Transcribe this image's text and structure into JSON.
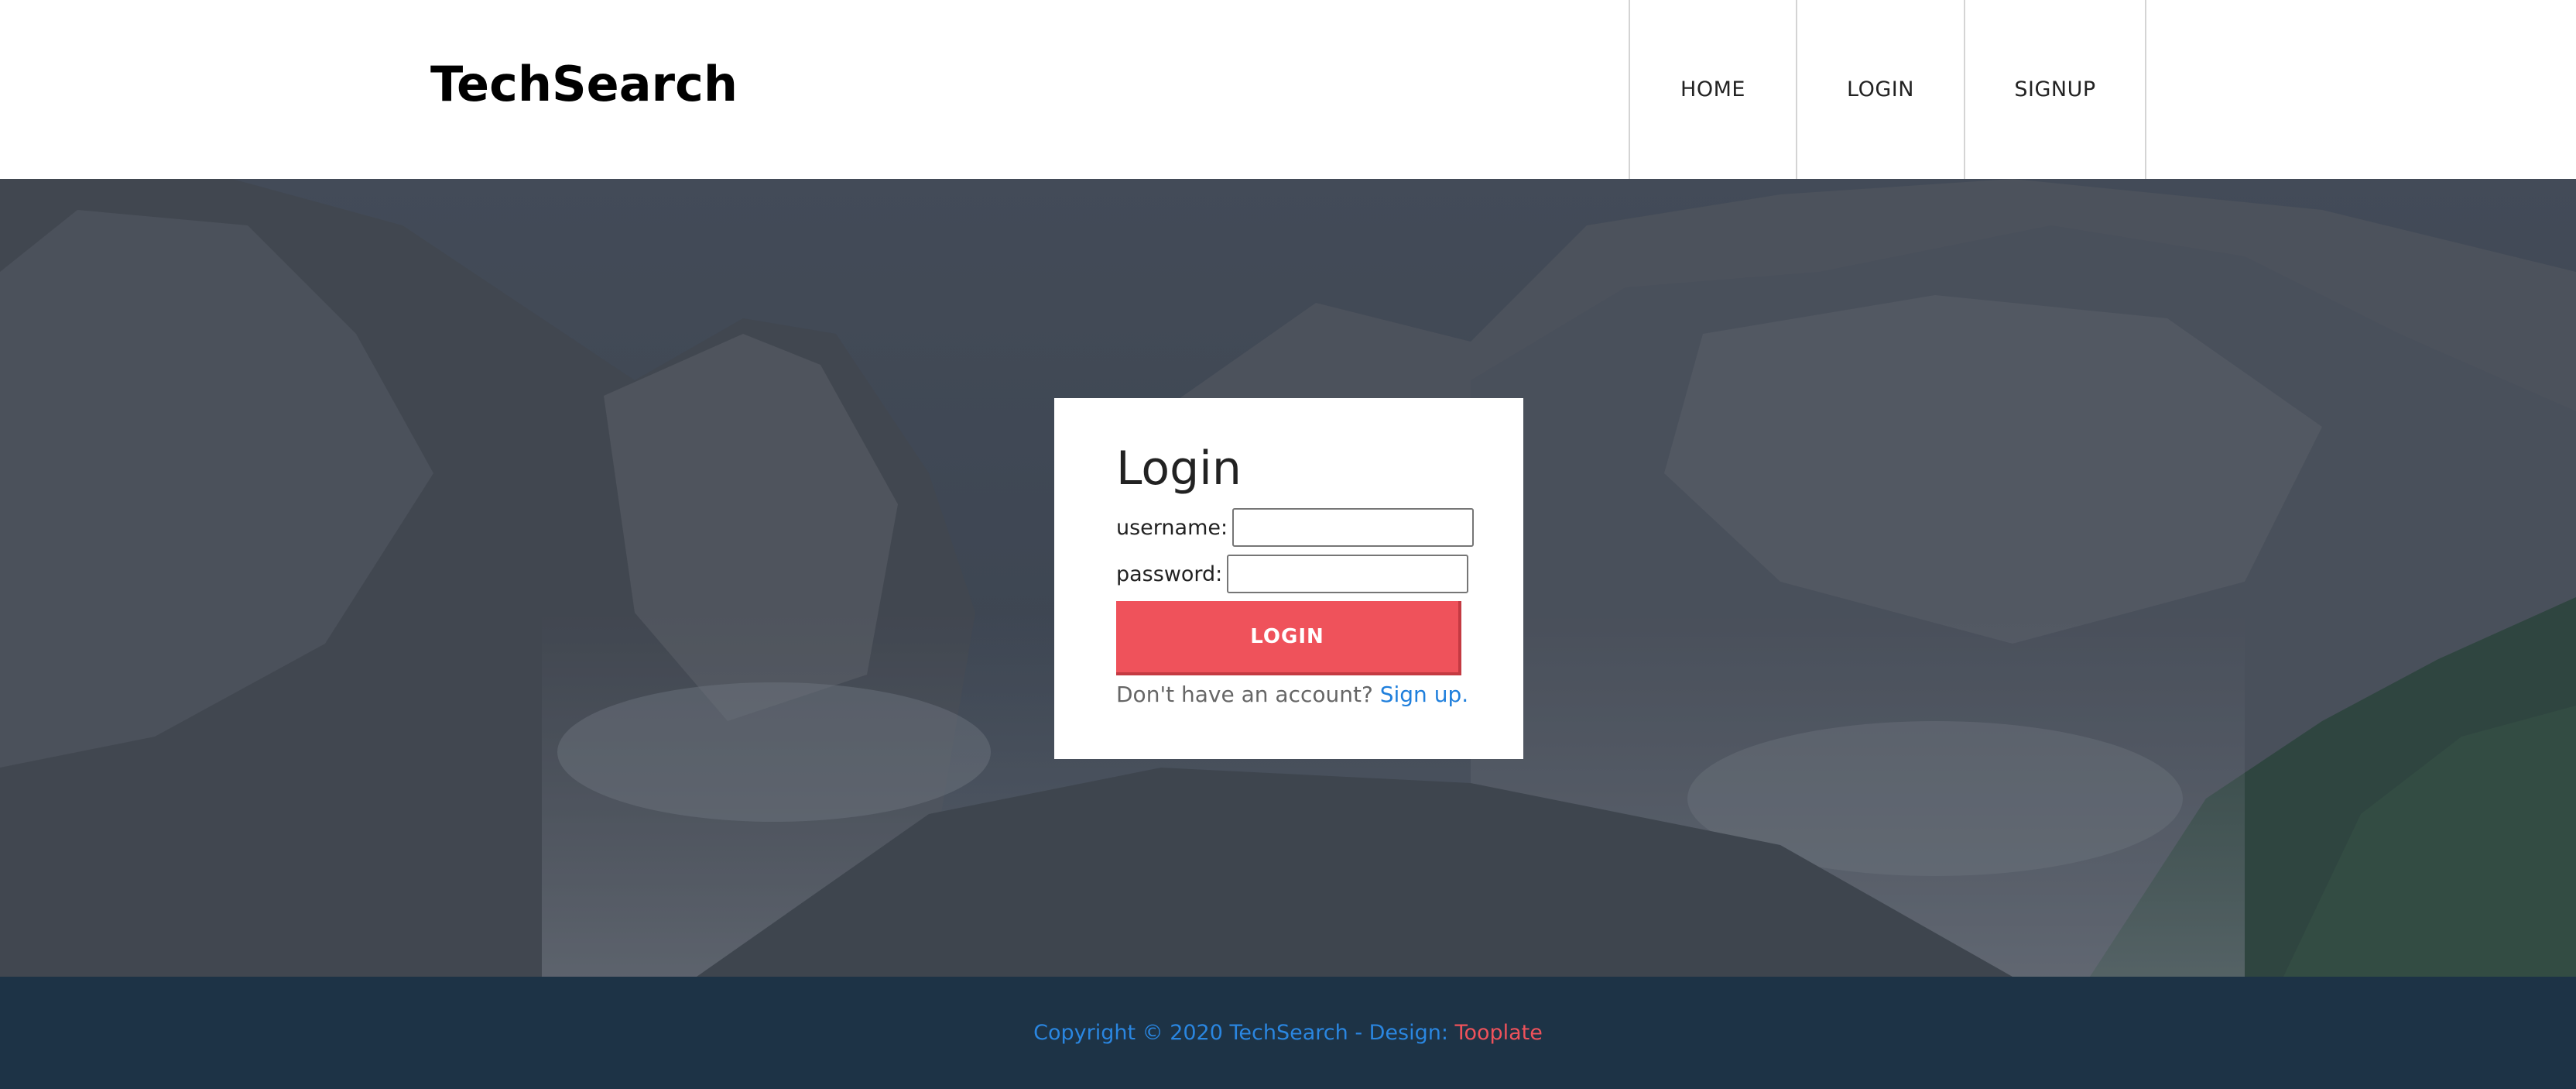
{
  "header": {
    "brand": "TechSearch",
    "nav": [
      {
        "label": "HOME"
      },
      {
        "label": "LOGIN"
      },
      {
        "label": "SIGNUP"
      }
    ]
  },
  "login_card": {
    "title": "Login",
    "username_label": "username:",
    "username_value": "",
    "password_label": "password:",
    "password_value": "",
    "submit_label": "LOGIN",
    "signup_prompt": "Don't have an account?",
    "signup_link": "Sign up."
  },
  "footer": {
    "copyright": "Copyright © 2020 TechSearch - Design:",
    "design_link": "Tooplate"
  },
  "colors": {
    "accent": "#ef525b",
    "link": "#1f7fdc",
    "footer_bg": "#1d3346",
    "hero_overlay": "#3c4652"
  },
  "background_image": "mountain-landscape"
}
